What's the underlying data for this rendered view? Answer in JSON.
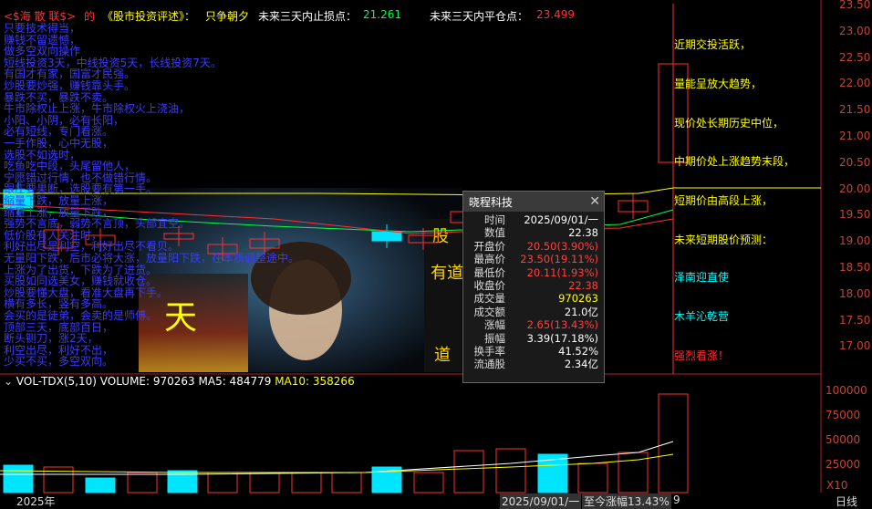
{
  "header": {
    "title": "<$海 散 联$>",
    "de": "的",
    "book": "《股市投资评述》：",
    "motto": "只争朝夕",
    "stop_label": "未来三天内止损点：",
    "stop_value": "21.261",
    "close_label": "未来三天内平仓点：",
    "close_value": "23.499"
  },
  "left_notes": [
    "只要技术得当，",
    "赚钱不留遗憾，",
    "做多空双向操作",
    "短线投资3天，中线投资5天，长线投资7天。",
    "有国才有家，国富才民强。",
    "炒股要炒强，赚钱靠头手。",
    "暴跌不买，暴跌不卖。",
    "牛市除权止上涨，牛市除权火上浇油，",
    "小阳、小阴，必有长阳，",
    "必有短线，专门看涨。",
    "一手作股，心中无股，",
    "选股不如选时，",
    "吃鱼吃中段，头尾留他人，",
    "宁愿错过行情，也不做错行情。",
    "跟庄要果断，选股要有第一手。",
    "缩量下跌，放量上涨，",
    "缩量上涨，放量下跌，",
    "强势不言底，弱势不言顶，头部宜空。",
    "低价股有人关注时，",
    "利好出尽是利空，利好出尽不看贝。",
    "无量阳下跌，后市必将大涨，放量阳下跌，在本质调整途中。",
    "上涨为了出货，下跌为了进货。",
    "买股如同选美女，赚钱就收仓。",
    "炒股要懂大盘，看准大盘再下手。",
    "横有多长，竖有多高。",
    "会买的是徒弟，会卖的是师傅。",
    "顶部三天，底部百日，",
    "断头铡刀，涨2天，",
    "利空出尽，利好不出，",
    "少买不买，多空双向。"
  ],
  "right_notes": [
    {
      "text": "近期交投活跃，",
      "color": "#ffff00"
    },
    {
      "text": "量能呈放大趋势，",
      "color": "#ffff00"
    },
    {
      "text": "现价处长期历史中位，",
      "color": "#ffff00"
    },
    {
      "text": "中期价处上涨趋势末段，",
      "color": "#ffff00"
    },
    {
      "text": "短期价由高段上涨，",
      "color": "#ffff00"
    },
    {
      "text": "未来短期股价预测：",
      "color": "#ffff00"
    },
    {
      "text": "泽南迎直使",
      "color": "#00ffff"
    },
    {
      "text": "木羊沁乾营",
      "color": "#00ffff"
    },
    {
      "text": "强烈看涨！",
      "color": "#ff3030"
    }
  ],
  "price_axis": [
    "23.50",
    "23.00",
    "22.50",
    "22.00",
    "21.50",
    "21.00",
    "20.50",
    "20.00",
    "19.50",
    "19.00",
    "18.50",
    "18.00",
    "17.50",
    "17.00"
  ],
  "volume_axis": [
    "100000",
    "75000",
    "50000",
    "25000"
  ],
  "volume_unit": "X10",
  "indicator": {
    "name": "VOL-TDX(5,10)",
    "volume": "VOLUME: 970263",
    "ma5": "MA5: 484779",
    "ma10": "MA10: 358266"
  },
  "tooltip": {
    "title": "晓程科技",
    "rows": [
      {
        "label": "时间",
        "value": "2025/09/01/一",
        "color": "#ffffff"
      },
      {
        "label": "数值",
        "value": "22.38",
        "color": "#ffffff"
      },
      {
        "label": "开盘价",
        "value": "20.50(3.90%)",
        "color": "#ff4040"
      },
      {
        "label": "最高价",
        "value": "23.50(19.11%)",
        "color": "#ff4040"
      },
      {
        "label": "最低价",
        "value": "20.11(1.93%)",
        "color": "#ff4040"
      },
      {
        "label": "收盘价",
        "value": "22.38",
        "color": "#ff4040"
      },
      {
        "label": "成交量",
        "value": "970263",
        "color": "#ffff00"
      },
      {
        "label": "成交额",
        "value": "21.0亿",
        "color": "#ffffff"
      },
      {
        "label": "涨幅",
        "value": "2.65(13.43%)",
        "color": "#ff4040"
      },
      {
        "label": "振幅",
        "value": "3.39(17.18%)",
        "color": "#ffffff"
      },
      {
        "label": "换手率",
        "value": "41.52%",
        "color": "#ffffff"
      },
      {
        "label": "流通股",
        "value": "2.34亿",
        "color": "#ffffff"
      }
    ]
  },
  "footer": {
    "year": "2025年",
    "date": "2025/09/01/一",
    "change": "至今涨幅13.43%",
    "day": "9",
    "period": "日线"
  },
  "overlay": {
    "left_char": "天",
    "right_chars": [
      "股",
      "有道，",
      "道"
    ]
  }
}
